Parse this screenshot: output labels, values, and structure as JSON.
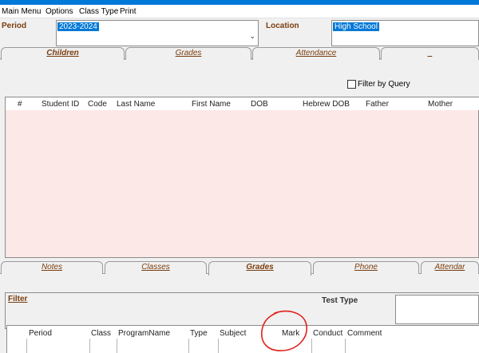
{
  "menu": [
    "Main Menu",
    "Options",
    "Class Type",
    "Print"
  ],
  "period": {
    "label": "Period",
    "value": "2023-2024"
  },
  "location": {
    "label": "Location",
    "value": "High School"
  },
  "top_tabs": [
    "Children",
    "Grades",
    "Attendance",
    "_"
  ],
  "filter_by_query": "Filter by Query",
  "children_columns": [
    "#",
    "Student ID",
    "Code",
    "Last Name",
    "First Name",
    "DOB",
    "Hebrew DOB",
    "Father",
    "Mother"
  ],
  "bottom_tabs": [
    "Notes",
    "Classes",
    "Grades",
    "Phone",
    "Attendar"
  ],
  "filter_label": "Filter",
  "test_type_label": "Test Type",
  "grades_columns": [
    "Period",
    "Class",
    "ProgramName",
    "Type",
    "Subject",
    "Mark",
    "Conduct",
    "Comment"
  ],
  "colors": {
    "accent": "#0078d7",
    "label_brown": "#7a3e0f",
    "grid_pink": "#fde8e8",
    "annotation_red": "#e0201a"
  }
}
